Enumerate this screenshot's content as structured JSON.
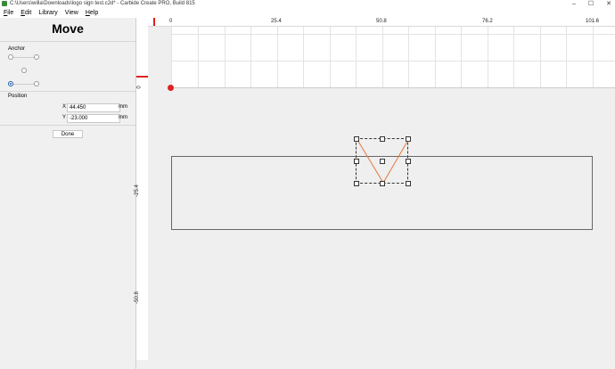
{
  "window": {
    "title": "C:\\Users\\willa\\Downloads\\logo sign test.c2d* - Carbide Create PRO, Build 815"
  },
  "menu": [
    {
      "label": "File",
      "key": "F",
      "rest": "ile"
    },
    {
      "label": "Edit",
      "key": "E",
      "rest": "dit"
    },
    {
      "label": "Library",
      "key": "",
      "rest": "Library"
    },
    {
      "label": "View",
      "key": "",
      "rest": "View"
    },
    {
      "label": "Help",
      "key": "H",
      "rest": "elp"
    }
  ],
  "panel": {
    "title": "Move",
    "anchor_label": "Anchor",
    "position_label": "Position",
    "x_label": "X",
    "x_value": "44.450",
    "x_unit": "mm",
    "y_label": "Y",
    "y_value": "-23.000",
    "y_unit": "mm",
    "done_label": "Done"
  },
  "ruler": {
    "top_labels": [
      "0",
      "25.4",
      "50.8",
      "76.2",
      "101.6"
    ],
    "left_labels": [
      "0",
      "-25.4",
      "-50.8"
    ]
  },
  "colors": {
    "accent": "#e02020",
    "path": "#e07a3a",
    "selection": "#333333"
  }
}
